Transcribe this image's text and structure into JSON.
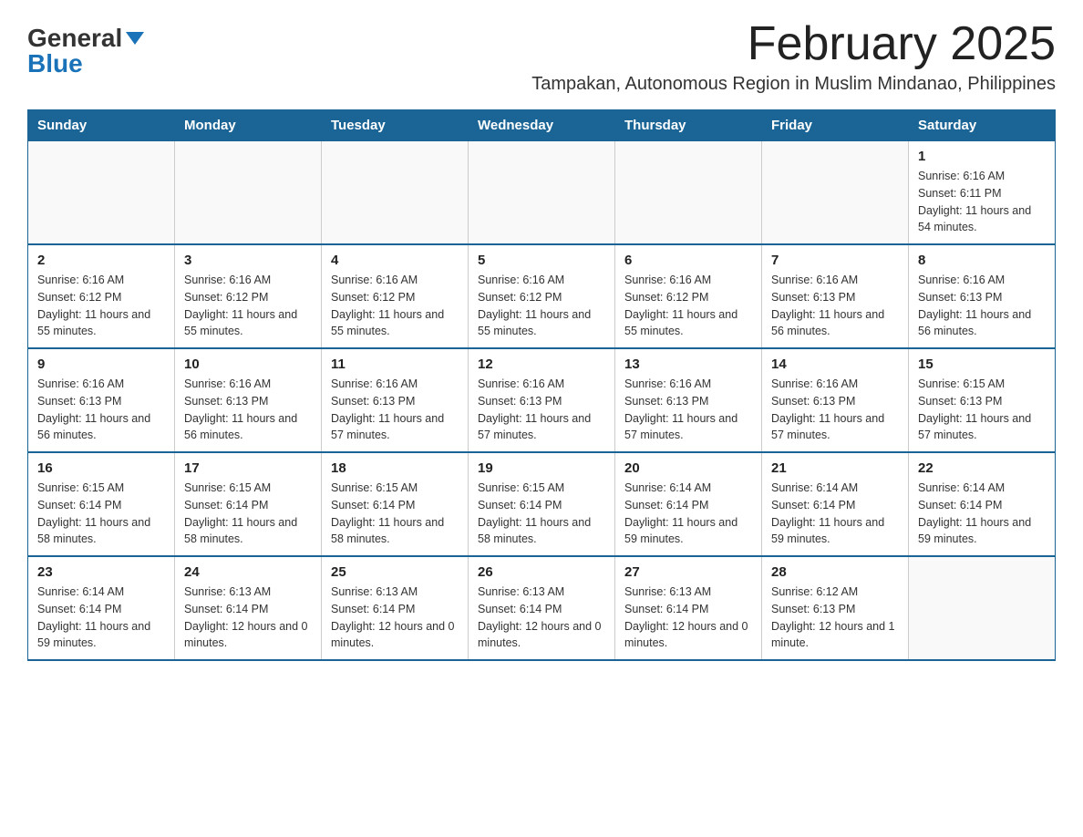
{
  "header": {
    "logo_general": "General",
    "logo_blue": "Blue",
    "title": "February 2025",
    "subtitle": "Tampakan, Autonomous Region in Muslim Mindanao, Philippines"
  },
  "calendar": {
    "days_of_week": [
      "Sunday",
      "Monday",
      "Tuesday",
      "Wednesday",
      "Thursday",
      "Friday",
      "Saturday"
    ],
    "weeks": [
      [
        {
          "day": "",
          "info": ""
        },
        {
          "day": "",
          "info": ""
        },
        {
          "day": "",
          "info": ""
        },
        {
          "day": "",
          "info": ""
        },
        {
          "day": "",
          "info": ""
        },
        {
          "day": "",
          "info": ""
        },
        {
          "day": "1",
          "info": "Sunrise: 6:16 AM\nSunset: 6:11 PM\nDaylight: 11 hours and 54 minutes."
        }
      ],
      [
        {
          "day": "2",
          "info": "Sunrise: 6:16 AM\nSunset: 6:12 PM\nDaylight: 11 hours and 55 minutes."
        },
        {
          "day": "3",
          "info": "Sunrise: 6:16 AM\nSunset: 6:12 PM\nDaylight: 11 hours and 55 minutes."
        },
        {
          "day": "4",
          "info": "Sunrise: 6:16 AM\nSunset: 6:12 PM\nDaylight: 11 hours and 55 minutes."
        },
        {
          "day": "5",
          "info": "Sunrise: 6:16 AM\nSunset: 6:12 PM\nDaylight: 11 hours and 55 minutes."
        },
        {
          "day": "6",
          "info": "Sunrise: 6:16 AM\nSunset: 6:12 PM\nDaylight: 11 hours and 55 minutes."
        },
        {
          "day": "7",
          "info": "Sunrise: 6:16 AM\nSunset: 6:13 PM\nDaylight: 11 hours and 56 minutes."
        },
        {
          "day": "8",
          "info": "Sunrise: 6:16 AM\nSunset: 6:13 PM\nDaylight: 11 hours and 56 minutes."
        }
      ],
      [
        {
          "day": "9",
          "info": "Sunrise: 6:16 AM\nSunset: 6:13 PM\nDaylight: 11 hours and 56 minutes."
        },
        {
          "day": "10",
          "info": "Sunrise: 6:16 AM\nSunset: 6:13 PM\nDaylight: 11 hours and 56 minutes."
        },
        {
          "day": "11",
          "info": "Sunrise: 6:16 AM\nSunset: 6:13 PM\nDaylight: 11 hours and 57 minutes."
        },
        {
          "day": "12",
          "info": "Sunrise: 6:16 AM\nSunset: 6:13 PM\nDaylight: 11 hours and 57 minutes."
        },
        {
          "day": "13",
          "info": "Sunrise: 6:16 AM\nSunset: 6:13 PM\nDaylight: 11 hours and 57 minutes."
        },
        {
          "day": "14",
          "info": "Sunrise: 6:16 AM\nSunset: 6:13 PM\nDaylight: 11 hours and 57 minutes."
        },
        {
          "day": "15",
          "info": "Sunrise: 6:15 AM\nSunset: 6:13 PM\nDaylight: 11 hours and 57 minutes."
        }
      ],
      [
        {
          "day": "16",
          "info": "Sunrise: 6:15 AM\nSunset: 6:14 PM\nDaylight: 11 hours and 58 minutes."
        },
        {
          "day": "17",
          "info": "Sunrise: 6:15 AM\nSunset: 6:14 PM\nDaylight: 11 hours and 58 minutes."
        },
        {
          "day": "18",
          "info": "Sunrise: 6:15 AM\nSunset: 6:14 PM\nDaylight: 11 hours and 58 minutes."
        },
        {
          "day": "19",
          "info": "Sunrise: 6:15 AM\nSunset: 6:14 PM\nDaylight: 11 hours and 58 minutes."
        },
        {
          "day": "20",
          "info": "Sunrise: 6:14 AM\nSunset: 6:14 PM\nDaylight: 11 hours and 59 minutes."
        },
        {
          "day": "21",
          "info": "Sunrise: 6:14 AM\nSunset: 6:14 PM\nDaylight: 11 hours and 59 minutes."
        },
        {
          "day": "22",
          "info": "Sunrise: 6:14 AM\nSunset: 6:14 PM\nDaylight: 11 hours and 59 minutes."
        }
      ],
      [
        {
          "day": "23",
          "info": "Sunrise: 6:14 AM\nSunset: 6:14 PM\nDaylight: 11 hours and 59 minutes."
        },
        {
          "day": "24",
          "info": "Sunrise: 6:13 AM\nSunset: 6:14 PM\nDaylight: 12 hours and 0 minutes."
        },
        {
          "day": "25",
          "info": "Sunrise: 6:13 AM\nSunset: 6:14 PM\nDaylight: 12 hours and 0 minutes."
        },
        {
          "day": "26",
          "info": "Sunrise: 6:13 AM\nSunset: 6:14 PM\nDaylight: 12 hours and 0 minutes."
        },
        {
          "day": "27",
          "info": "Sunrise: 6:13 AM\nSunset: 6:14 PM\nDaylight: 12 hours and 0 minutes."
        },
        {
          "day": "28",
          "info": "Sunrise: 6:12 AM\nSunset: 6:13 PM\nDaylight: 12 hours and 1 minute."
        },
        {
          "day": "",
          "info": ""
        }
      ]
    ]
  }
}
